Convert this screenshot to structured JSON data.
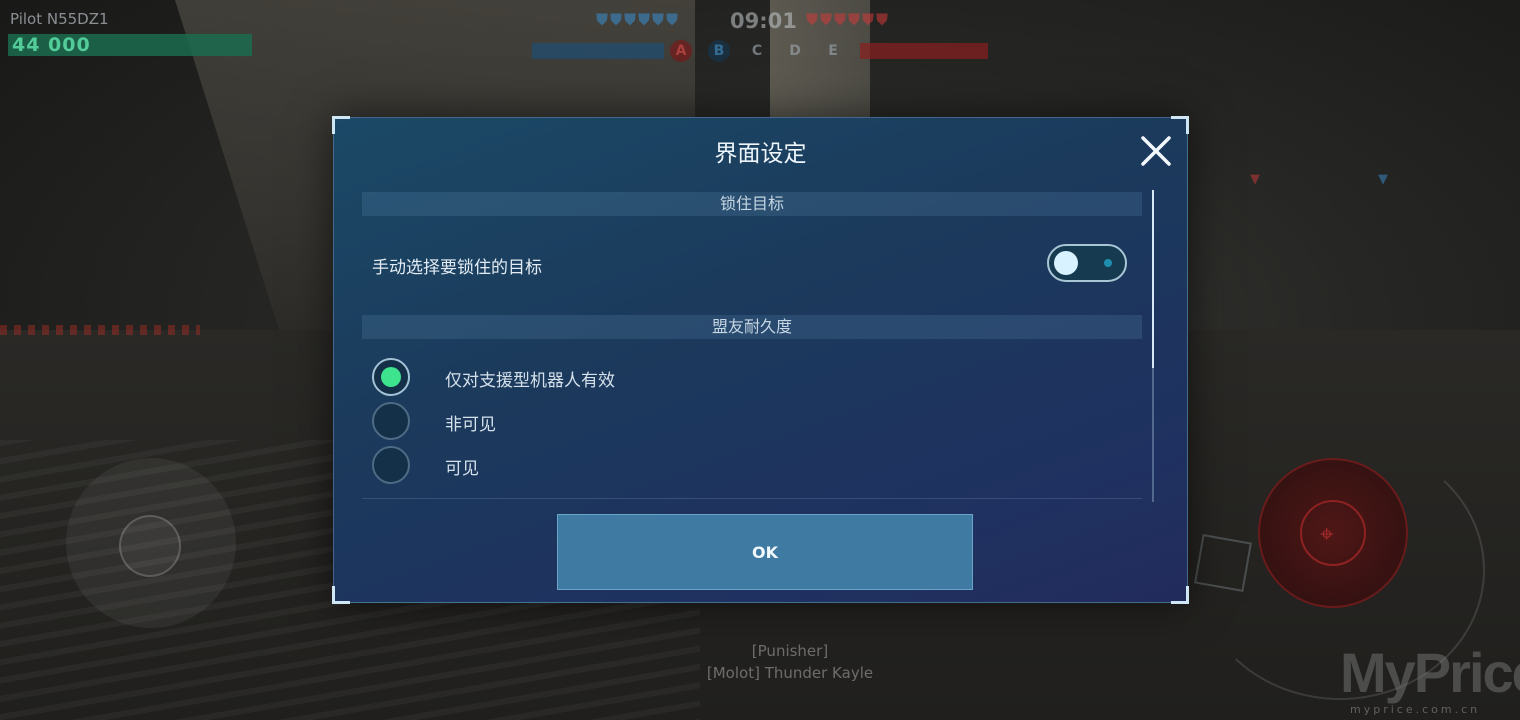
{
  "hud": {
    "pilot_name": "Pilot N55DZ1",
    "health": "44 000",
    "timer": "09:01",
    "beacons": [
      "A",
      "B",
      "C",
      "D",
      "E"
    ],
    "killfeed": [
      "[Punisher]",
      "[Molot] Thunder Kayle"
    ]
  },
  "dialog": {
    "title": "界面设定",
    "close_icon": "close-x-icon",
    "sections": [
      {
        "header": "锁住目标",
        "toggle": {
          "label": "手动选择要锁住的目标",
          "on": false
        }
      },
      {
        "header": "盟友耐久度",
        "options": [
          {
            "label": "仅对支援型机器人有效",
            "selected": true
          },
          {
            "label": "非可见",
            "selected": false
          },
          {
            "label": "可见",
            "selected": false
          }
        ]
      }
    ],
    "ok_label": "OK"
  },
  "watermark": {
    "brand": "MyPrice",
    "domain": "myprice.com.cn"
  },
  "colors": {
    "dialog_bg": "#1b3a5c",
    "radio_selected": "#3ee38e",
    "ok_button": "#3f7aa3",
    "team_blue": "#3a8fd1",
    "team_red": "#d13a3a"
  }
}
